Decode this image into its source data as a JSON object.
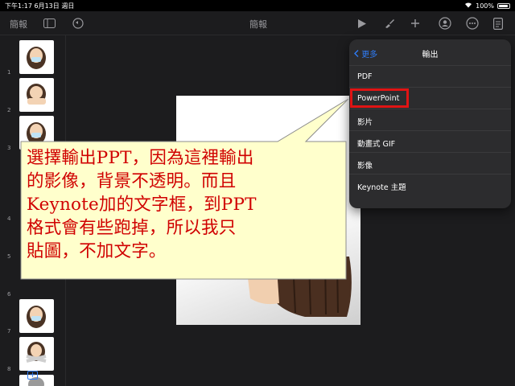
{
  "status_bar": {
    "time_date": "下午1:17  6月13日 週日",
    "battery": "100%"
  },
  "toolbar": {
    "left_label": "簡報",
    "doc_title": "簡報"
  },
  "slides": [
    {
      "number": "1"
    },
    {
      "number": "2"
    },
    {
      "number": "3"
    },
    {
      "number": "4"
    },
    {
      "number": "5"
    },
    {
      "number": "6"
    },
    {
      "number": "7"
    },
    {
      "number": "8"
    }
  ],
  "export_menu": {
    "back_label": "更多",
    "title": "輸出",
    "items": [
      "PDF",
      "PowerPoint",
      "影片",
      "動畫式 GIF",
      "影像",
      "Keynote 主題"
    ],
    "highlighted": "PowerPoint"
  },
  "callout": {
    "lines": [
      "選擇輸出PPT，因為這裡輸出",
      "的影像，背景不透明。而且",
      "Keynote加的文字框，到PPT",
      "格式會有些跑掉，所以我只",
      "貼圖，不加文字。"
    ]
  },
  "colors": {
    "accent": "#2f7cf6",
    "highlight": "#e01414",
    "callout_fill": "#ffffcc",
    "callout_text": "#d00000"
  },
  "icons": [
    "sidebar-toggle-icon",
    "undo-icon",
    "play-icon",
    "paintbrush-icon",
    "plus-icon",
    "collaborate-icon",
    "more-icon",
    "document-icon",
    "wifi-icon",
    "battery-icon"
  ]
}
